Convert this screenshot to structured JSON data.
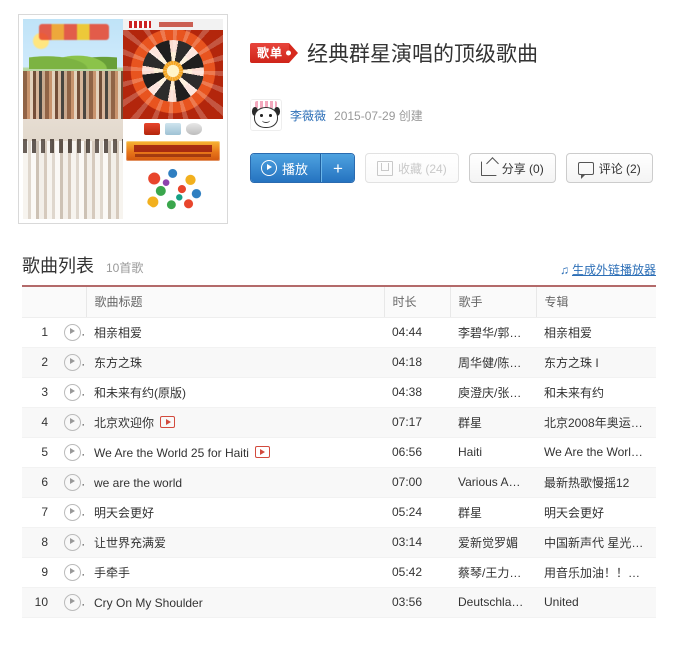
{
  "header": {
    "badge_label": "歌单",
    "playlist_title": "经典群星演唱的顶级歌曲",
    "author_name": "李薇薇",
    "created_text": "2015-07-29 创建",
    "cover_alt": "经典群星演唱的顶级歌曲 封面"
  },
  "actions": {
    "play_label": "播放",
    "add_label": "+",
    "favorite_label": "收藏 (24)",
    "share_label": "分享 (0)",
    "comment_label": "评论 (2)"
  },
  "list": {
    "title": "歌曲列表",
    "count_text": "10首歌",
    "external_player_label": "生成外链播放器",
    "note_icon": "♫",
    "columns": {
      "index": "",
      "play": "",
      "title": "歌曲标题",
      "duration": "时长",
      "artist": "歌手",
      "album": "专辑"
    },
    "rows": [
      {
        "index": "1",
        "title": "相亲相爱",
        "mv": false,
        "duration": "04:44",
        "artist": "李碧华/郭…",
        "album": "相亲相爱"
      },
      {
        "index": "2",
        "title": "东方之珠",
        "mv": false,
        "duration": "04:18",
        "artist": "周华健/陈…",
        "album": "东方之珠 I"
      },
      {
        "index": "3",
        "title": "和未来有约(原版)",
        "mv": false,
        "duration": "04:38",
        "artist": "庾澄庆/张…",
        "album": "和未来有约"
      },
      {
        "index": "4",
        "title": "北京欢迎你",
        "mv": true,
        "duration": "07:17",
        "artist": "群星",
        "album": "北京2008年奥运…"
      },
      {
        "index": "5",
        "title": "We Are the World 25 for Haiti",
        "mv": true,
        "duration": "06:56",
        "artist": "Haiti",
        "album": "We Are the Worl…"
      },
      {
        "index": "6",
        "title": "we are the world",
        "mv": false,
        "duration": "07:00",
        "artist": "Various A…",
        "album": "最新热歌慢摇12"
      },
      {
        "index": "7",
        "title": "明天会更好",
        "mv": false,
        "duration": "05:24",
        "artist": "群星",
        "album": "明天会更好"
      },
      {
        "index": "8",
        "title": "让世界充满爱",
        "mv": false,
        "duration": "03:14",
        "artist": "爱新觉罗媚",
        "album": "中国新声代 星光…"
      },
      {
        "index": "9",
        "title": "手牵手",
        "mv": false,
        "duration": "05:42",
        "artist": "蔡琴/王力…",
        "album": "用音乐加油！！…"
      },
      {
        "index": "10",
        "title": "Cry On My Shoulder",
        "mv": false,
        "duration": "03:56",
        "artist": "Deutschla…",
        "album": "United"
      }
    ]
  },
  "colors": {
    "badge_red": "#cf2419",
    "button_blue": "#2573c0",
    "link_blue": "#2d6fb7",
    "rule_red": "#8b1a1a"
  }
}
